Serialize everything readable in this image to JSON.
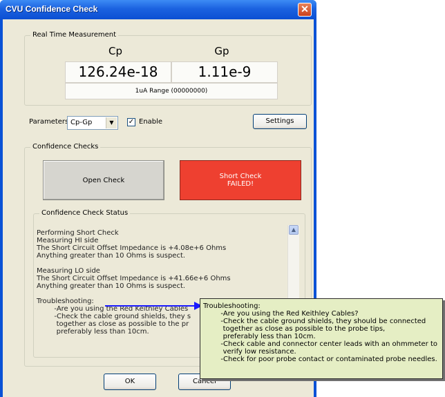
{
  "window": {
    "title": "CVU Confidence Check",
    "close_glyph": "✕"
  },
  "realtime": {
    "group_label": "Real Time Measurement",
    "cp_label": "Cp",
    "gp_label": "Gp",
    "cp_value": "126.24e-18",
    "gp_value": "1.11e-9",
    "range": "1uA Range (00000000)"
  },
  "params": {
    "label": "Parameters:",
    "selected": "Cp-Gp",
    "enable_label": "Enable",
    "enable_checked": true,
    "settings_label": "Settings"
  },
  "checks": {
    "group_label": "Confidence Checks",
    "open_label": "Open Check",
    "short_label_1": "Short Check",
    "short_label_2": "FAILED!",
    "short_color": "#ee4030"
  },
  "status": {
    "group_label": "Confidence Check Status",
    "lines": [
      "Performing Short Check",
      "Measuring HI side",
      "The Short Circuit Offset Impedance is +4.08e+6 Ohms",
      "Anything greater than 10 Ohms is suspect.",
      "",
      "Measuring LO side",
      "The Short Circuit Offset Impedance is +41.66e+6 Ohms",
      "Anything greater than 10 Ohms is suspect.",
      "",
      "Troubleshooting:",
      "        -Are you using the Red Keithley Cables",
      "        -Check the cable ground shields, they s",
      "         together as close as possible to the pr",
      "         preferably less than 10cm."
    ]
  },
  "footer": {
    "ok_label": "OK",
    "cancel_label": "Cancel"
  },
  "callout": {
    "lines": [
      "Troubleshooting:",
      "        -Are you using the Red Keithley Cables?",
      "        -Check the cable ground shields, they should be connected",
      "         together as close as possible to the probe tips,",
      "         preferably less than 10cm.",
      "        -Check cable and connector center leads with an ohmmeter to",
      "         verify low resistance.",
      "        -Check for poor probe contact or contaminated probe needles."
    ],
    "arrow_color": "#1a1aff"
  }
}
